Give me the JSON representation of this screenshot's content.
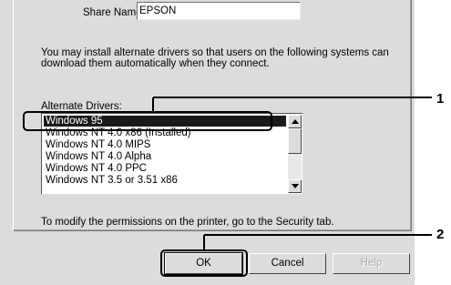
{
  "share": {
    "label": "Share Name:",
    "value": "EPSON"
  },
  "info": {
    "line1": "You may install alternate drivers so that users on the following systems can",
    "line2": "download them automatically when they connect."
  },
  "alternate_drivers": {
    "label": "Alternate Drivers:",
    "items": [
      {
        "label": "Windows 95",
        "selected": true
      },
      {
        "label": "Windows NT 4.0 x86 (Installed)",
        "selected": false
      },
      {
        "label": "Windows NT 4.0 MIPS",
        "selected": false
      },
      {
        "label": "Windows NT 4.0 Alpha",
        "selected": false
      },
      {
        "label": "Windows NT 4.0 PPC",
        "selected": false
      },
      {
        "label": "Windows NT 3.5 or 3.51 x86",
        "selected": false
      }
    ]
  },
  "permissions_note": "To modify the permissions on the printer, go to the Security tab.",
  "buttons": {
    "ok": "OK",
    "cancel": "Cancel",
    "help": "Help"
  },
  "callouts": {
    "first": "1",
    "second": "2"
  },
  "colors": {
    "dialog_bg": "#dcdcdc",
    "selection_bg": "#1a1a1a",
    "disabled_text": "#a8a8a8"
  }
}
